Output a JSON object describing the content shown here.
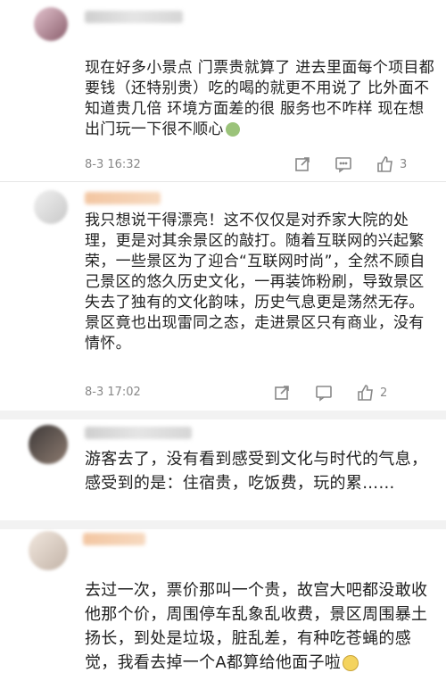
{
  "comments": [
    {
      "text": "现在好多小景点 门票贵就算了 进去里面每个项目都要钱（还特别贵）吃的喝的就更不用说了 比外面不知道贵几倍 环境方面差的很 服务也不咋样 现在想出门玩一下很不顺心",
      "time": "8-3 16:32",
      "likes": "3",
      "emoji": "nausea-emoji"
    },
    {
      "text": "我只想说干得漂亮！这不仅仅是对乔家大院的处理，更是对其余景区的敲打。随着互联网的兴起繁荣，一些景区为了迎合“互联网时尚”，全然不顾自己景区的悠久历史文化，一再装饰粉刷，导致景区失去了独有的文化韵味，历史气息更是荡然无存。景区竟也出现雷同之态，走进景区只有商业，没有情怀。",
      "time": "8-3 17:02",
      "likes": "2"
    },
    {
      "text": "游客去了，没有看到感受到文化与时代的气息，感受到的是：住宿贵，吃饭费，玩的累……"
    },
    {
      "text": "去过一次，票价那叫一个贵，故宫大吧都没敢收他那个价，周围停车乱象乱收费，景区周围暴土扬长，到处是垃圾，脏乱差，有种吃苍蝇的感觉，我看去掉一个A都算给他面子啦",
      "emoji": "glasses-emoji"
    }
  ],
  "colors": {
    "divider": "#f2f2f2",
    "meta": "#888888",
    "text": "#222222"
  }
}
